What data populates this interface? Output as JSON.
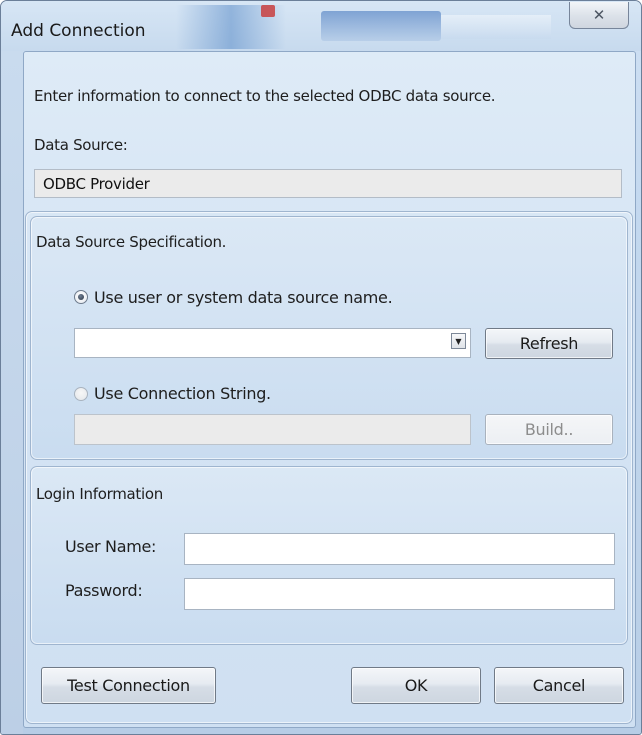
{
  "window": {
    "title": "Add Connection",
    "close_glyph": "✕"
  },
  "intro": {
    "text": "Enter information to connect to the selected ODBC data source."
  },
  "data_source": {
    "label": "Data Source:",
    "value": "ODBC Provider"
  },
  "spec": {
    "group_label": "Data Source Specification.",
    "radio_dsn_label": "Use user or system data source name.",
    "radio_dsn_checked": true,
    "dsn_value": "",
    "refresh_label": "Refresh",
    "radio_connstr_label": "Use Connection String.",
    "radio_connstr_checked": false,
    "connstr_value": "",
    "build_label": "Build.."
  },
  "login": {
    "group_label": "Login Information",
    "username_label": "User Name:",
    "username_value": "",
    "password_label": "Password:",
    "password_value": ""
  },
  "buttons": {
    "test_label": "Test Connection",
    "ok_label": "OK",
    "cancel_label": "Cancel"
  },
  "icons": {
    "dropdown": "chevron-down-icon",
    "close": "close-icon"
  },
  "colors": {
    "window_bg": "#cfe0f3",
    "panel_bg": "#d5e4f4",
    "readonly_bg": "#ebebeb"
  }
}
